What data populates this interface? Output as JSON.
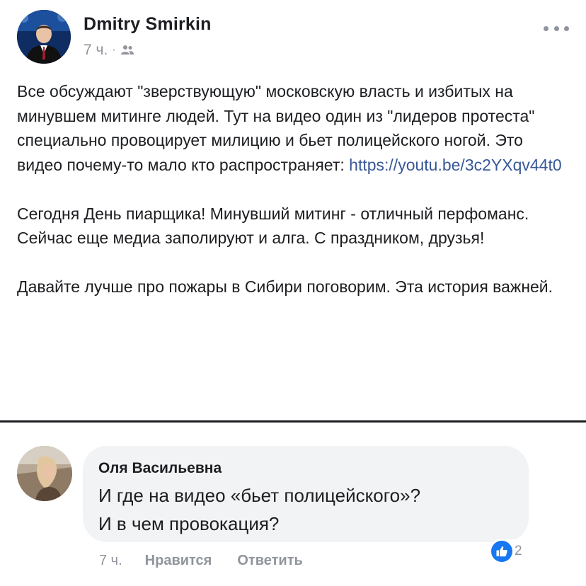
{
  "post": {
    "author": "Dmitry Smirkin",
    "time": "7 ч.",
    "meta_separator": "·",
    "privacy_icon": "friends-icon",
    "more_icon": "more-dots-icon",
    "paragraphs": {
      "p1_text": "Все обсуждают \"зверствующую\" московскую власть и избитых на минувшем митинге людей. Тут на видео один из \"лидеров протеста\" специально провоцирует милицию и бьет полицейского ногой. Это видео почему-то мало кто распространяет: ",
      "p1_link": "https://youtu.be/3c2YXqv44t0",
      "p2_text": "Сегодня День пиарщика! Минувший митинг - отличный перфоманс. Сейчас еще медиа заполируют и алга. С праздником, друзья!",
      "p3_text": "Давайте лучше про пожары в Сибири поговорим. Эта история важней."
    }
  },
  "comment": {
    "author": "Оля Васильевна",
    "line1": "И где на видео «бьет полицейского»?",
    "line2": "И в чем провокация?",
    "time": "7 ч.",
    "like_label": "Нравится",
    "reply_label": "Ответить",
    "reaction_icon": "like-icon",
    "reaction_count": "2"
  },
  "colors": {
    "link": "#385898",
    "muted": "#90949c",
    "bubble": "#f2f3f5",
    "like_blue": "#1877f2"
  }
}
